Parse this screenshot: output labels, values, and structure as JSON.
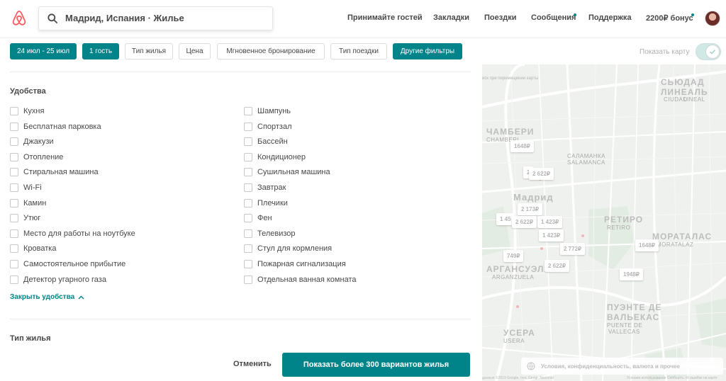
{
  "header": {
    "search_text": "Мадрид, Испания · Жилье",
    "nav": {
      "host": "Принимайте гостей",
      "saved": "Закладки",
      "trips": "Поездки",
      "messages": "Сообщения",
      "help": "Поддержка",
      "bonus": "2200₽ бонус"
    }
  },
  "filters": {
    "dates": "24 июл - 25 июл",
    "guests": "1 гость",
    "home_type": "Тип жилья",
    "price": "Цена",
    "instant_book": "Мгновенное бронирование",
    "trip_type": "Тип поездки",
    "more_filters": "Другие фильтры",
    "show_map": "Показать карту"
  },
  "amenities": {
    "title": "Удобства",
    "left": [
      "Кухня",
      "Бесплатная парковка",
      "Джакузи",
      "Отопление",
      "Стиральная машина",
      "Wi-Fi",
      "Камин",
      "Утюг",
      "Место для работы на ноутбуке",
      "Кроватка",
      "Самостоятельное прибытие",
      "Детектор угарного газа"
    ],
    "right": [
      "Шампунь",
      "Спортзал",
      "Бассейн",
      "Кондиционер",
      "Сушильная машина",
      "Завтрак",
      "Плечики",
      "Фен",
      "Телевизор",
      "Стул для кормления",
      "Пожарная сигнализация",
      "Отдельная ванная комната"
    ],
    "collapse": "Закрыть удобства"
  },
  "property_type": {
    "title": "Тип жилья"
  },
  "actions": {
    "cancel": "Отменить",
    "show": "Показать более 300 вариантов жилья"
  },
  "map": {
    "search_as_move": "иск при перемещении карты",
    "footer": "Условия, конфиденциальность, валюта и прочее",
    "districts": {
      "chamberi": "ЧАМБЕРИ",
      "chamberi_lat": "CHAMBERI",
      "salamanca": "САЛАМАНКА",
      "salamanca_lat": "SALAMANCA",
      "madrid": "Мадрид",
      "retiro": "РЕТИРО",
      "retiro_lat": "RETIRO",
      "arganzuela": "АРГАНСУЭЛА",
      "arganzuela_lat": "ARGANZUELA",
      "moratalaz": "МОРАТАЛАС",
      "moratalaz_lat": "MORATALAZ",
      "usera": "УСЕРА",
      "usera_lat": "USERA",
      "puente": "ПУЭНТЕ ДЕ",
      "vallecas": "ВАЛЬЕКАС",
      "puente_lat": "PUENTE DE",
      "vallecas_lat": "VALLECAS",
      "ciudad": "СЬЮДАД",
      "lineal": "ЛИНЕАЛЬ",
      "ciudad_lat": "CIUDAD",
      "lineal_lat": "LINEAL"
    },
    "prices": [
      "1648₽",
      "2 622₽",
      "2 173₽",
      "2 622₽",
      "1 423₽",
      "1 423₽",
      "2 772₽",
      "749₽",
      "2 622₽",
      "1648₽",
      "1948₽",
      "1 45",
      "2"
    ],
    "copyright": "данные ©2019 Google, Inst. Geogr. Nacional",
    "report": "Условия использования   Сообщить об ошибке на карте"
  }
}
